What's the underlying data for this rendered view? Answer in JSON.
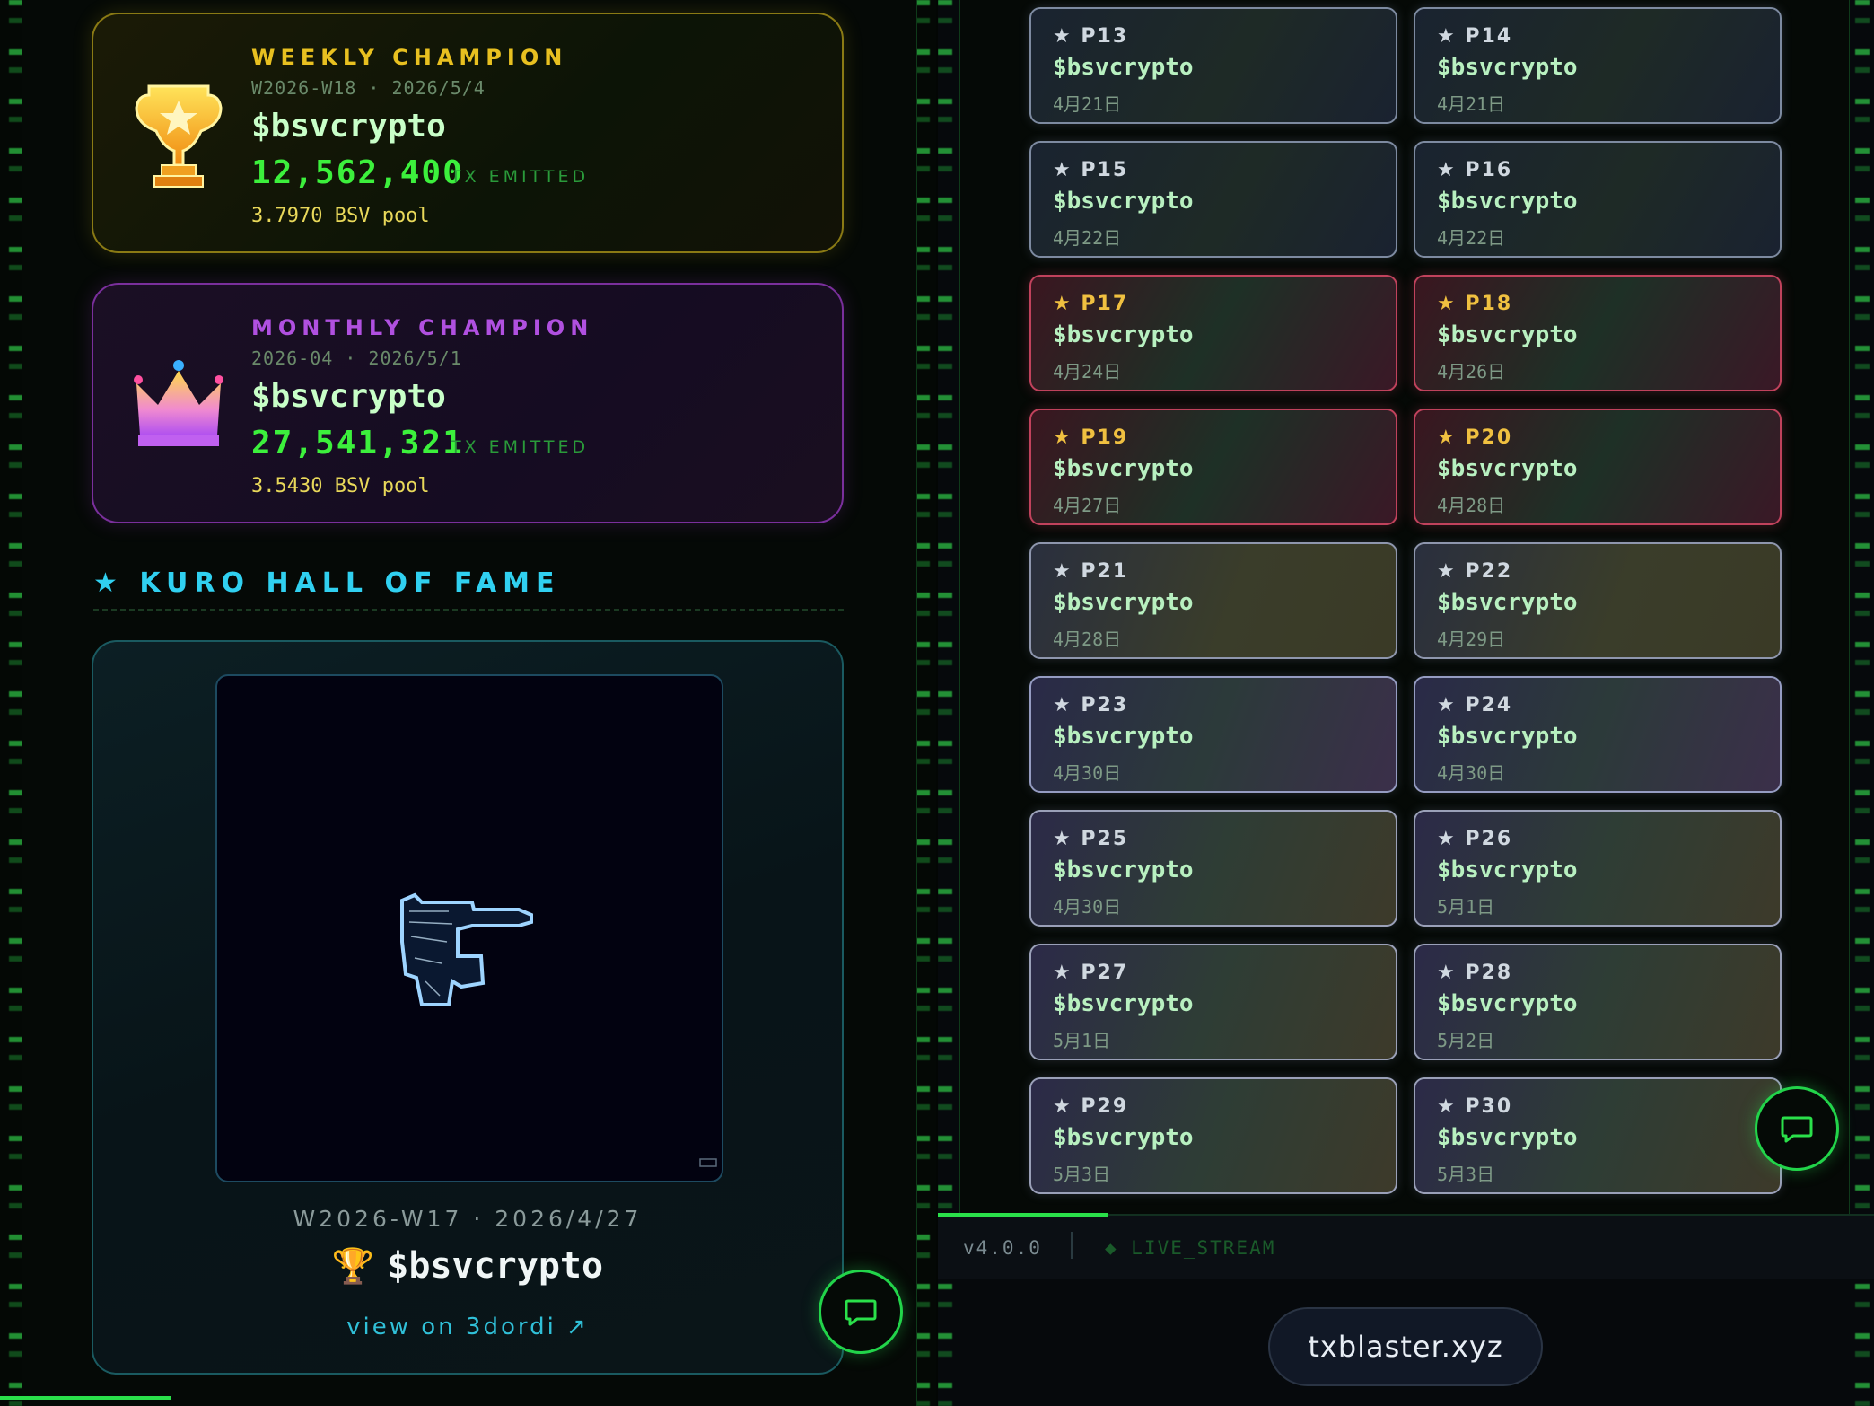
{
  "weekly": {
    "title": "WEEKLY CHAMPION",
    "period": "W2026-W18 · 2026/5/4",
    "ticker": "$bsvcrypto",
    "tx_count": "12,562,400",
    "tx_label": "TX EMITTED",
    "pool": "3.7970 BSV pool"
  },
  "monthly": {
    "title": "MONTHLY CHAMPION",
    "period": "2026-04 · 2026/5/1",
    "ticker": "$bsvcrypto",
    "tx_count": "27,541,321",
    "tx_label": "TX EMITTED",
    "pool": "3.5430 BSV pool"
  },
  "hall_of_fame": {
    "heading": "★ KURO HALL OF FAME",
    "meta": "W2026-W17 · 2026/4/27",
    "trophy": "🏆",
    "ticker": "$bsvcrypto",
    "link": "view on 3dordi ↗"
  },
  "grid": [
    {
      "label": "★ P13",
      "ticker": "$bsvcrypto",
      "date": "4月21日",
      "style": "default"
    },
    {
      "label": "★ P14",
      "ticker": "$bsvcrypto",
      "date": "4月21日",
      "style": "default"
    },
    {
      "label": "★ P15",
      "ticker": "$bsvcrypto",
      "date": "4月22日",
      "style": "default"
    },
    {
      "label": "★ P16",
      "ticker": "$bsvcrypto",
      "date": "4月22日",
      "style": "default"
    },
    {
      "label": "★ P17",
      "ticker": "$bsvcrypto",
      "date": "4月24日",
      "style": "pink"
    },
    {
      "label": "★ P18",
      "ticker": "$bsvcrypto",
      "date": "4月26日",
      "style": "pink"
    },
    {
      "label": "★ P19",
      "ticker": "$bsvcrypto",
      "date": "4月27日",
      "style": "pink"
    },
    {
      "label": "★ P20",
      "ticker": "$bsvcrypto",
      "date": "4月28日",
      "style": "pink"
    },
    {
      "label": "★ P21",
      "ticker": "$bsvcrypto",
      "date": "4月28日",
      "style": "gold"
    },
    {
      "label": "★ P22",
      "ticker": "$bsvcrypto",
      "date": "4月29日",
      "style": "gold"
    },
    {
      "label": "★ P23",
      "ticker": "$bsvcrypto",
      "date": "4月30日",
      "style": "violet"
    },
    {
      "label": "★ P24",
      "ticker": "$bsvcrypto",
      "date": "4月30日",
      "style": "violet"
    },
    {
      "label": "★ P25",
      "ticker": "$bsvcrypto",
      "date": "4月30日",
      "style": "mix"
    },
    {
      "label": "★ P26",
      "ticker": "$bsvcrypto",
      "date": "5月1日",
      "style": "mix"
    },
    {
      "label": "★ P27",
      "ticker": "$bsvcrypto",
      "date": "5月1日",
      "style": "mix"
    },
    {
      "label": "★ P28",
      "ticker": "$bsvcrypto",
      "date": "5月2日",
      "style": "mix"
    },
    {
      "label": "★ P29",
      "ticker": "$bsvcrypto",
      "date": "5月3日",
      "style": "mix"
    },
    {
      "label": "★ P30",
      "ticker": "$bsvcrypto",
      "date": "5月3日",
      "style": "mix"
    }
  ],
  "footer": {
    "version": "v4.0.0",
    "stream": "◆ LIVE_STREAM",
    "site": "txblaster.xyz"
  },
  "icons": {
    "weekly": "trophy-icon",
    "monthly": "crown-icon",
    "chat": "chat-bubble-icon"
  },
  "colors": {
    "accent_green": "#3cf03c",
    "weekly_gold": "#e8c020",
    "monthly_purple": "#b050e0",
    "hof_cyan": "#30d0f0"
  }
}
